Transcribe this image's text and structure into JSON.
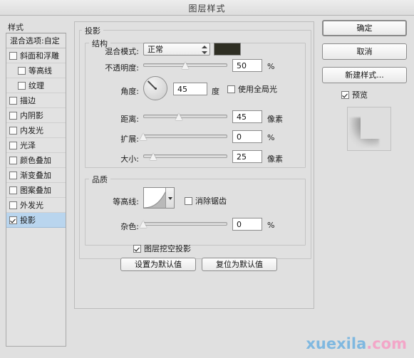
{
  "window": {
    "title": "图层样式"
  },
  "styles_panel": {
    "header_label": "样式",
    "blending_options_label": "混合选项:自定",
    "items": [
      {
        "label": "斜面和浮雕",
        "checked": false,
        "indent": false
      },
      {
        "label": "等高线",
        "checked": false,
        "indent": true
      },
      {
        "label": "纹理",
        "checked": false,
        "indent": true
      },
      {
        "label": "描边",
        "checked": false,
        "indent": false
      },
      {
        "label": "内阴影",
        "checked": false,
        "indent": false
      },
      {
        "label": "内发光",
        "checked": false,
        "indent": false
      },
      {
        "label": "光泽",
        "checked": false,
        "indent": false
      },
      {
        "label": "颜色叠加",
        "checked": false,
        "indent": false
      },
      {
        "label": "渐变叠加",
        "checked": false,
        "indent": false
      },
      {
        "label": "图案叠加",
        "checked": false,
        "indent": false
      },
      {
        "label": "外发光",
        "checked": false,
        "indent": false
      },
      {
        "label": "投影",
        "checked": true,
        "indent": false,
        "selected": true
      }
    ]
  },
  "main": {
    "section_title": "投影",
    "structure": {
      "group_label": "结构",
      "blend_mode": {
        "label": "混合模式:",
        "value": "正常",
        "color_swatch": "#2e2e23"
      },
      "opacity": {
        "label": "不透明度:",
        "value": "50",
        "unit": "%",
        "slider_percent": 50
      },
      "angle": {
        "label": "角度:",
        "value": "45",
        "unit": "度",
        "dial_degrees": 45,
        "use_global_light": {
          "label": "使用全局光",
          "checked": false
        }
      },
      "distance": {
        "label": "距离:",
        "value": "45",
        "unit": "像素",
        "slider_percent": 42
      },
      "spread": {
        "label": "扩展:",
        "value": "0",
        "unit": "%",
        "slider_percent": 0
      },
      "size": {
        "label": "大小:",
        "value": "25",
        "unit": "像素",
        "slider_percent": 12
      }
    },
    "quality": {
      "group_label": "品质",
      "contour": {
        "label": "等高线:",
        "anti_alias": {
          "label": "消除锯齿",
          "checked": false
        }
      },
      "noise": {
        "label": "杂色:",
        "value": "0",
        "unit": "%",
        "slider_percent": 0
      }
    },
    "layer_knocks_out": {
      "label": "图层挖空投影",
      "checked": true
    },
    "make_default_button": "设置为默认值",
    "reset_default_button": "复位为默认值"
  },
  "right_panel": {
    "ok_button": "确定",
    "cancel_button": "取消",
    "new_style_button": "新建样式...",
    "preview": {
      "label": "预览",
      "checked": true
    }
  },
  "watermark": {
    "name": "xuexila",
    "tld": ".com",
    "name_color": "#7fb8e0",
    "tld_color": "#f3a6c8"
  }
}
